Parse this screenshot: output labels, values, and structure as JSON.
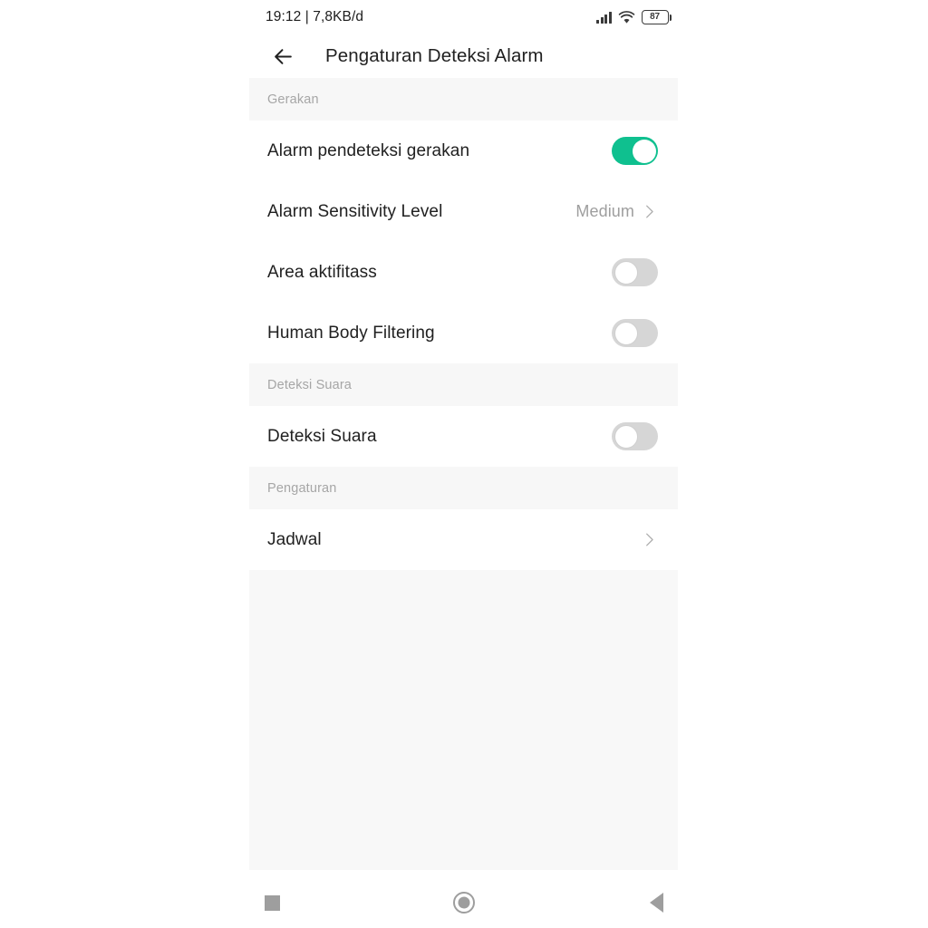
{
  "status_bar": {
    "time_and_data": "19:12 | 7,8KB/d",
    "signal_icon": "signal-bars-icon",
    "wifi_icon": "wifi-icon",
    "battery_icon": "battery-icon",
    "battery_level": "87"
  },
  "app_bar": {
    "back_icon": "back-arrow-icon",
    "title": "Pengaturan Deteksi Alarm"
  },
  "sections": [
    {
      "header": "Gerakan",
      "rows": [
        {
          "label": "Alarm pendeteksi gerakan",
          "control": "toggle",
          "state": "on"
        },
        {
          "label": "Alarm Sensitivity Level",
          "control": "value-chevron",
          "value": "Medium"
        },
        {
          "label": "Area aktifitass",
          "control": "toggle",
          "state": "off"
        },
        {
          "label": "Human Body Filtering",
          "control": "toggle",
          "state": "off"
        }
      ]
    },
    {
      "header": "Deteksi Suara",
      "rows": [
        {
          "label": "Deteksi Suara",
          "control": "toggle",
          "state": "off"
        }
      ]
    },
    {
      "header": "Pengaturan",
      "rows": [
        {
          "label": "Jadwal",
          "control": "chevron"
        }
      ]
    }
  ],
  "nav_bar": {
    "recents_icon": "square-recents-icon",
    "home_icon": "circle-home-icon",
    "back_icon": "triangle-back-icon"
  },
  "colors": {
    "toggle_on": "#0fc08f",
    "toggle_off": "#d6d6d6",
    "section_header_bg": "#f7f7f7",
    "section_header_text": "#a6a6a6",
    "row_text": "#212121",
    "row_value_text": "#9e9e9e",
    "filler_bg": "#f8f8f8",
    "nav_icon": "#9e9e9e"
  }
}
